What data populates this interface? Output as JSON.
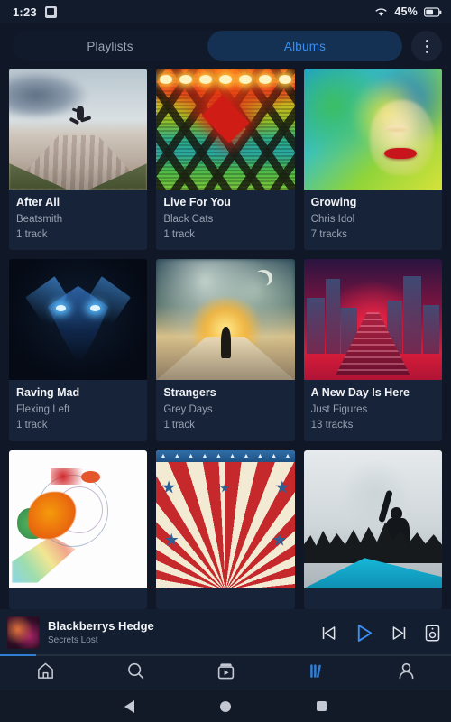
{
  "status_bar": {
    "time": "1:23",
    "app_icon": "screenshot-icon",
    "wifi_icon": "wifi-icon",
    "battery_percent": "45%",
    "battery_icon": "battery-icon"
  },
  "tabs": {
    "playlists_label": "Playlists",
    "albums_label": "Albums",
    "active": "Albums",
    "overflow_icon": "kebab-menu-icon",
    "active_color": "#3b8ff0",
    "active_pill_color": "#143052"
  },
  "albums": [
    {
      "title": "After All",
      "artist": "Beatsmith",
      "tracks": "1 track",
      "art": "runner-on-road"
    },
    {
      "title": "Live For You",
      "artist": "Black Cats",
      "tracks": "1 track",
      "art": "chevron-lights"
    },
    {
      "title": "Growing",
      "artist": "Chris Idol",
      "tracks": "7 tracks",
      "art": "watercolor-face"
    },
    {
      "title": "Raving Mad",
      "artist": "Flexing Left",
      "tracks": "1 track",
      "art": "glowing-eyes-creature"
    },
    {
      "title": "Strangers",
      "artist": "Grey Days",
      "tracks": "1 track",
      "art": "sunset-figure"
    },
    {
      "title": "A New Day Is Here",
      "artist": "Just Figures",
      "tracks": "13 tracks",
      "art": "red-city-steps"
    },
    {
      "title": "",
      "artist": "",
      "tracks": "",
      "art": "paint-splatter"
    },
    {
      "title": "",
      "artist": "",
      "tracks": "",
      "art": "red-starburst"
    },
    {
      "title": "",
      "artist": "",
      "tracks": "",
      "art": "concert-crowd"
    }
  ],
  "now_playing": {
    "title": "Blackberrys Hedge",
    "artist": "Secrets Lost",
    "thumbnail": "album-thumbnail",
    "previous_icon": "skip-previous-icon",
    "play_icon": "play-icon",
    "next_icon": "skip-next-icon",
    "output_icon": "audio-output-icon",
    "progress_percent": 8,
    "progress_color": "#2f7fd4"
  },
  "bottom_nav": {
    "items": [
      {
        "name": "home",
        "icon": "home-icon",
        "active": false
      },
      {
        "name": "search",
        "icon": "search-icon",
        "active": false
      },
      {
        "name": "videos",
        "icon": "video-box-icon",
        "active": false
      },
      {
        "name": "library",
        "icon": "library-icon",
        "active": true
      },
      {
        "name": "profile",
        "icon": "person-icon",
        "active": false
      }
    ],
    "active_color": "#2f7fd4",
    "inactive_color": "#c3c8d2"
  },
  "system_nav": {
    "back_icon": "back-triangle-icon",
    "home_icon": "home-circle-icon",
    "recents_icon": "recents-square-icon"
  }
}
